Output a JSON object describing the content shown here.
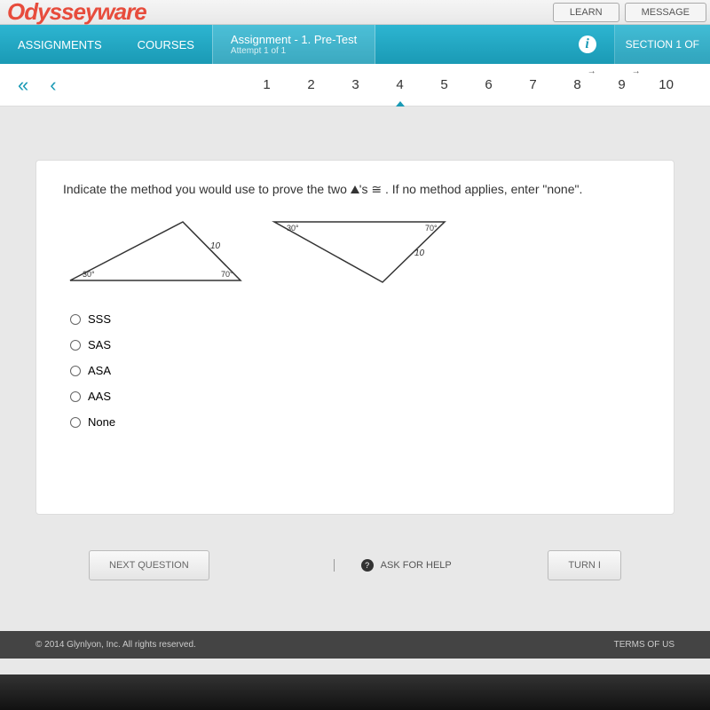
{
  "logo": "Odysseyware",
  "top_buttons": {
    "learn": "LEARN",
    "message": "MESSAGE"
  },
  "nav": {
    "assignments": "ASSIGNMENTS",
    "courses": "COURSES",
    "assignment_label": "Assignment",
    "assignment_title": "- 1. Pre-Test",
    "attempt": "Attempt 1 of 1",
    "section": "SECTION 1 OF"
  },
  "question_nav": {
    "numbers": [
      "1",
      "2",
      "3",
      "4",
      "5",
      "6",
      "7",
      "8",
      "9",
      "10"
    ],
    "current": 4
  },
  "question": {
    "prompt_before": "Indicate the method you would use to prove the two ",
    "prompt_mid": "'s ≅ . If no method applies, enter \"none\".",
    "triangle1": {
      "angle_left": "30°",
      "angle_right": "70°",
      "side": "10"
    },
    "triangle2": {
      "angle_left": "30°",
      "angle_right": "70°",
      "side": "10"
    },
    "options": [
      "SSS",
      "SAS",
      "ASA",
      "AAS",
      "None"
    ]
  },
  "buttons": {
    "next": "NEXT QUESTION",
    "ask": "ASK FOR HELP",
    "turn": "TURN I"
  },
  "footer": {
    "copyright": "© 2014 Glynlyon, Inc. All rights reserved.",
    "terms": "TERMS OF US"
  }
}
